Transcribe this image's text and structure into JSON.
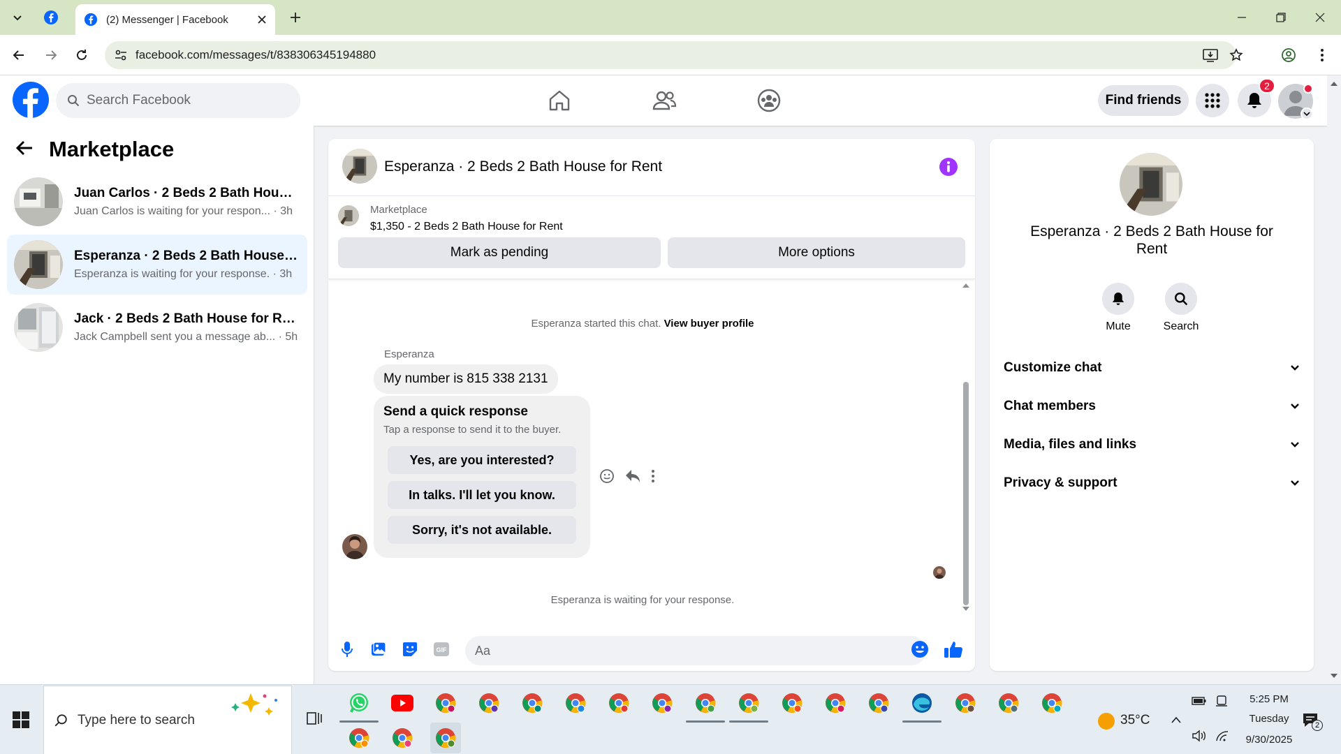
{
  "browser": {
    "tab_title": "(2) Messenger | Facebook",
    "url": "facebook.com/messages/t/838306345194880"
  },
  "fb": {
    "search_placeholder": "Search Facebook",
    "find_friends": "Find friends",
    "notification_count": "2"
  },
  "sidebar": {
    "title": "Marketplace",
    "conversations": [
      {
        "name": "Juan Carlos · 2 Beds 2 Bath House ...",
        "preview": "Juan Carlos is waiting for your respon... · 3h"
      },
      {
        "name": "Esperanza · 2 Beds 2 Bath House f...",
        "preview": "Esperanza is waiting for your response. · 3h"
      },
      {
        "name": "Jack · 2 Beds 2 Bath House for Rent",
        "preview": "Jack Campbell sent you a message ab... · 5h"
      }
    ]
  },
  "chat": {
    "title": "Esperanza · 2 Beds 2 Bath House for Rent",
    "listing_label": "Marketplace",
    "listing_price": "$1,350 - 2 Beds 2 Bath House for Rent",
    "mark_pending": "Mark as pending",
    "more_options": "More options",
    "started_text": "Esperanza started this chat.",
    "view_buyer_profile": "View buyer profile",
    "sender": "Esperanza",
    "message": "My number is 815 338 2131",
    "quick_title": "Send a quick response",
    "quick_sub": "Tap a response to send it to the buyer.",
    "quick_responses": [
      "Yes, are you interested?",
      "In talks. I'll let you know.",
      "Sorry, it's not available."
    ],
    "waiting": "Esperanza is waiting for your response.",
    "composer_placeholder": "Aa"
  },
  "details": {
    "title": "Esperanza · 2 Beds 2 Bath House for Rent",
    "mute": "Mute",
    "search": "Search",
    "sections": [
      "Customize chat",
      "Chat members",
      "Media, files and links",
      "Privacy & support"
    ]
  },
  "taskbar": {
    "search_placeholder": "Type here to search",
    "weather": "35°C",
    "time": "5:25 PM",
    "day": "Tuesday",
    "date": "9/30/2025",
    "notif_count": "2"
  },
  "colors": {
    "fb_blue": "#0866ff",
    "accent_purple": "#a033ff",
    "badge_red": "#e41e3f"
  }
}
